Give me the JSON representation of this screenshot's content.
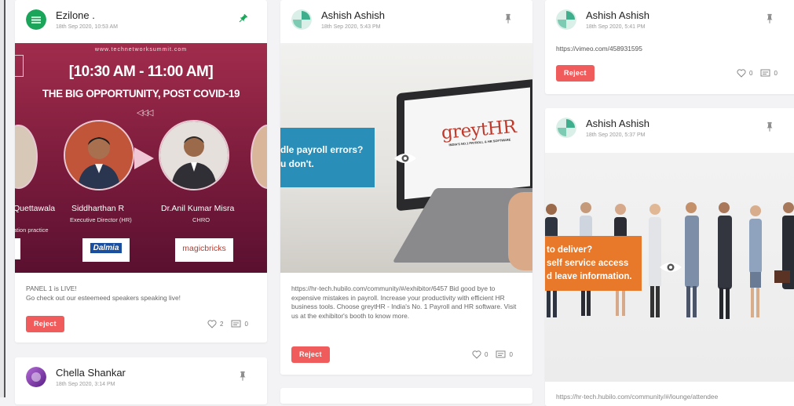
{
  "posts": [
    {
      "author": "Ezilone .",
      "date": "18th Sep 2020, 10:53 AM",
      "pinned": true,
      "avatar_color": "#1aa55a",
      "banner": {
        "site": "www.technetworksummit.com",
        "time": "[10:30 AM - 11:00 AM]",
        "headline": "THE BIG OPPORTUNITY, POST COVID-19",
        "speakers": [
          {
            "name": "Quettawala",
            "role": "ation practice"
          },
          {
            "name": "Siddharthan R",
            "role": "Executive Director (HR)"
          },
          {
            "name": "Dr.Anil Kumar Misra",
            "role": "CHRO"
          }
        ],
        "logos": [
          "Dalmia",
          "magicbricks"
        ]
      },
      "text_lines": [
        "PANEL 1 is LIVE!",
        "Go check out our esteemeed speakers speaking live!"
      ],
      "reject_label": "Reject",
      "likes": "2",
      "comments": "0"
    },
    {
      "author": "Chella Shankar",
      "date": "18th Sep 2020, 3:14 PM",
      "pinned": false,
      "avatar_color": "#7b3fa8"
    },
    {
      "author": "Ashish Ashish",
      "date": "18th Sep 2020, 5:43 PM",
      "pinned": false,
      "avatar_color": "#4fb59a",
      "banner": {
        "overlay_line1": "dle payroll errors?",
        "overlay_line2": "u don't.",
        "brand": "greytHR",
        "brand_tag": "INDIA'S NO.1 PAYROLL & HR SOFTWARE"
      },
      "text": "https://hr-tech.hubilo.com/community/#/exhibitor/6457 Bid good bye to expensive mistakes in payroll. Increase your productivity with efficient HR business tools. Choose greytHR - India's No. 1 Payroll and HR software. Visit us at the exhibitor's booth to know more.",
      "reject_label": "Reject",
      "likes": "0",
      "comments": "0"
    },
    {
      "author": "Ashish Ashish",
      "date": "18th Sep 2020, 5:41 PM",
      "pinned": false,
      "avatar_color": "#4fb59a",
      "text": "https://vimeo.com/458931595",
      "reject_label": "Reject",
      "likes": "0",
      "comments": "0"
    },
    {
      "author": "Ashish Ashish",
      "date": "18th Sep 2020, 5:37 PM",
      "pinned": false,
      "avatar_color": "#4fb59a",
      "banner": {
        "overlay_line1": "to deliver?",
        "overlay_line2": "self service access",
        "overlay_line3": "d leave information."
      },
      "text": "https://hr-tech.hubilo.com/community/#/lounge/attendee"
    }
  ],
  "colors": {
    "reject": "#f05c5c",
    "pin_active": "#1aa55a",
    "pin_inactive": "#8d8d8d",
    "banner_gradient_top": "#9a2a4a",
    "banner_gradient_bottom": "#5a1030",
    "overlay_blue": "#2a8fb8",
    "overlay_orange": "#e8782a"
  }
}
